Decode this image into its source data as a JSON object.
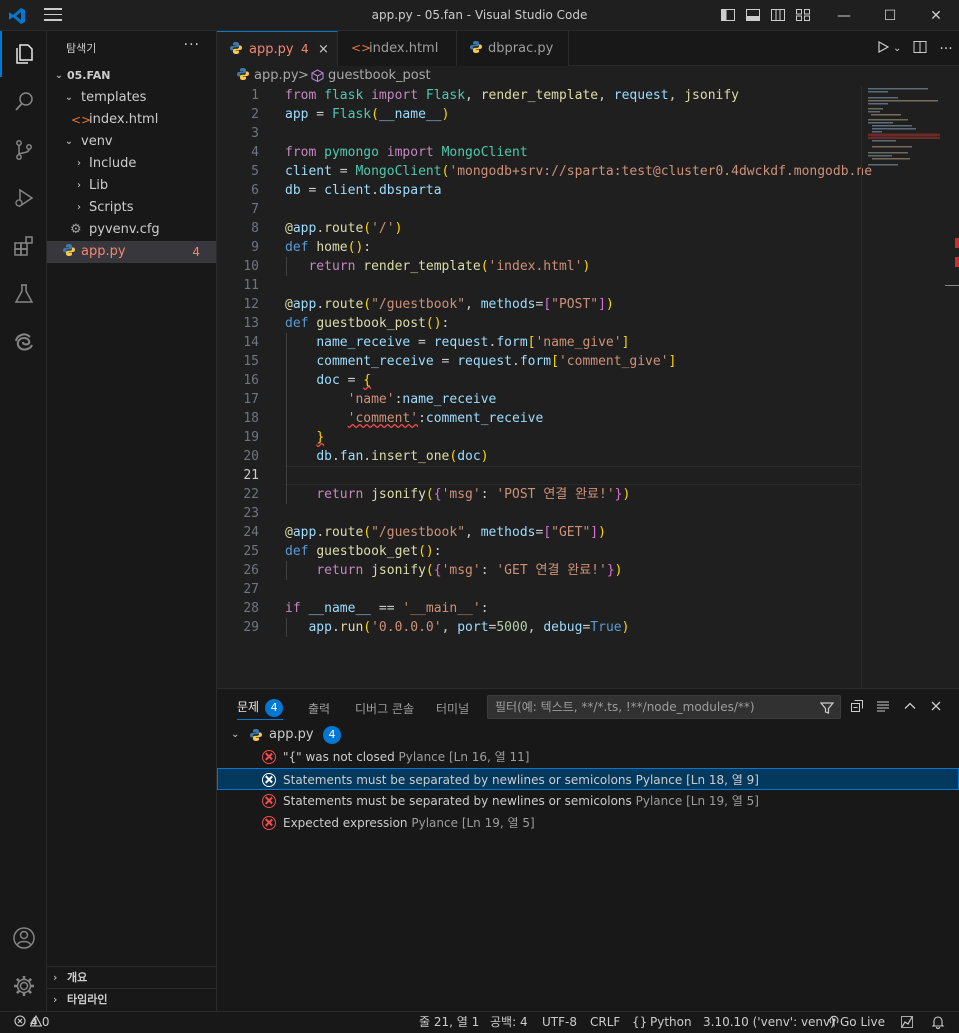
{
  "window": {
    "title": "app.py - 05.fan - Visual Studio Code",
    "controls": {
      "minimize": "—",
      "maximize": "☐",
      "close": "✕"
    }
  },
  "activity_bar": {
    "items": [
      "explorer-icon",
      "search-icon",
      "source-control-icon",
      "run-debug-icon",
      "extensions-icon",
      "testing-icon",
      "edge-devtools-icon"
    ],
    "bottom": [
      "account-icon",
      "settings-gear-icon"
    ]
  },
  "explorer": {
    "header": "탐색기",
    "more": "···",
    "root": "05.FAN",
    "items": [
      {
        "label": "templates",
        "type": "folder-open"
      },
      {
        "label": "index.html",
        "type": "html-file"
      },
      {
        "label": "venv",
        "type": "folder-open"
      },
      {
        "label": "Include",
        "type": "folder-closed"
      },
      {
        "label": "Lib",
        "type": "folder-closed"
      },
      {
        "label": "Scripts",
        "type": "folder-closed"
      },
      {
        "label": "pyvenv.cfg",
        "type": "config-file"
      },
      {
        "label": "app.py",
        "type": "python-file",
        "badge": "4"
      }
    ],
    "sections": [
      "개요",
      "타임라인"
    ]
  },
  "tabs": [
    {
      "label": "app.py",
      "count": "4",
      "close": "×",
      "active": true
    },
    {
      "label": "index.html",
      "active": false
    },
    {
      "label": "dbprac.py",
      "active": false
    }
  ],
  "breadcrumb": {
    "file": "app.py",
    "sep": ">",
    "symbol": "guestbook_post"
  },
  "editor": {
    "line_numbers": [
      "1",
      "2",
      "3",
      "4",
      "5",
      "6",
      "7",
      "8",
      "9",
      "10",
      "11",
      "12",
      "13",
      "14",
      "15",
      "16",
      "17",
      "18",
      "19",
      "20",
      "21",
      "22",
      "23",
      "24",
      "25",
      "26",
      "27",
      "28",
      "29"
    ],
    "current_line": "21"
  },
  "panel": {
    "tabs": [
      {
        "label": "문제",
        "badge": "4",
        "active": true
      },
      {
        "label": "출력"
      },
      {
        "label": "디버그 콘솔"
      },
      {
        "label": "터미널"
      }
    ],
    "filter_placeholder": "필터(예: 텍스트, **/*.ts, !**/node_modules/**)",
    "file": {
      "name": "app.py",
      "badge": "4"
    },
    "problems": [
      {
        "message": "\"{\" was not closed",
        "source": "Pylance",
        "location": "[Ln 16, 열 11]"
      },
      {
        "message": "Statements must be separated by newlines or semicolons",
        "source": "Pylance",
        "location": "[Ln 18, 열 9]",
        "selected": true
      },
      {
        "message": "Statements must be separated by newlines or semicolons",
        "source": "Pylance",
        "location": "[Ln 19, 열 5]"
      },
      {
        "message": "Expected expression",
        "source": "Pylance",
        "location": "[Ln 19, 열 5]"
      }
    ]
  },
  "status_bar": {
    "errors": "4",
    "warnings": "0",
    "position": "줄 21, 열 1",
    "spaces": "공백: 4",
    "encoding": "UTF-8",
    "eol": "CRLF",
    "language": "Python",
    "interpreter": "3.10.10 ('venv': venv)",
    "golive": "Go Live"
  }
}
